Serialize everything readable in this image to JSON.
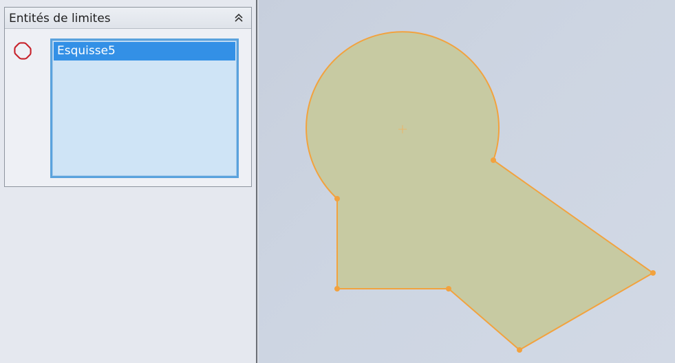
{
  "panel": {
    "title": "Entités de limites",
    "collapse_icon": "chevron-double-up-icon",
    "selection_icon": "boundary-entity-icon",
    "list": {
      "items": [
        "Esquisse5"
      ],
      "selected_index": 0
    }
  },
  "viewport": {
    "sketch": {
      "fill_color": "#c7caa2",
      "edge_color": "#f2a23e",
      "center_mark": "+"
    }
  },
  "colors": {
    "panel_bg": "#e5e8ef",
    "selection": "#3390e6",
    "list_bg": "#cfe4f6",
    "viewport_bg": "#ccd4e1"
  }
}
